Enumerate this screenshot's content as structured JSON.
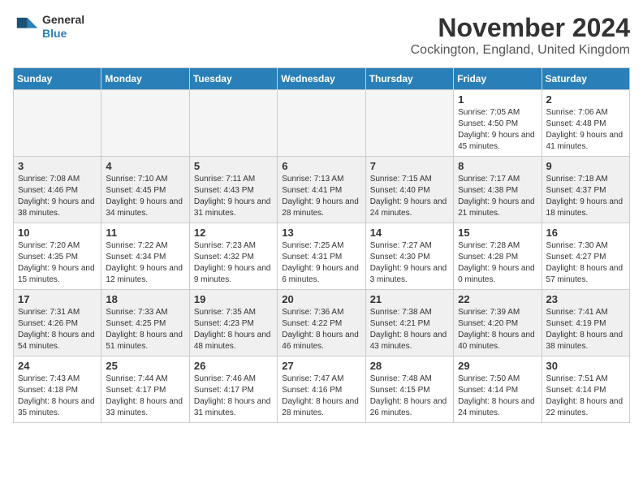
{
  "logo": {
    "line1": "General",
    "line2": "Blue"
  },
  "title": "November 2024",
  "subtitle": "Cockington, England, United Kingdom",
  "header": {
    "days": [
      "Sunday",
      "Monday",
      "Tuesday",
      "Wednesday",
      "Thursday",
      "Friday",
      "Saturday"
    ]
  },
  "weeks": [
    [
      {
        "day": "",
        "empty": true
      },
      {
        "day": "",
        "empty": true
      },
      {
        "day": "",
        "empty": true
      },
      {
        "day": "",
        "empty": true
      },
      {
        "day": "",
        "empty": true
      },
      {
        "day": "1",
        "rise": "7:05 AM",
        "set": "4:50 PM",
        "daylight": "9 hours and 45 minutes."
      },
      {
        "day": "2",
        "rise": "7:06 AM",
        "set": "4:48 PM",
        "daylight": "9 hours and 41 minutes."
      }
    ],
    [
      {
        "day": "3",
        "rise": "7:08 AM",
        "set": "4:46 PM",
        "daylight": "9 hours and 38 minutes."
      },
      {
        "day": "4",
        "rise": "7:10 AM",
        "set": "4:45 PM",
        "daylight": "9 hours and 34 minutes."
      },
      {
        "day": "5",
        "rise": "7:11 AM",
        "set": "4:43 PM",
        "daylight": "9 hours and 31 minutes."
      },
      {
        "day": "6",
        "rise": "7:13 AM",
        "set": "4:41 PM",
        "daylight": "9 hours and 28 minutes."
      },
      {
        "day": "7",
        "rise": "7:15 AM",
        "set": "4:40 PM",
        "daylight": "9 hours and 24 minutes."
      },
      {
        "day": "8",
        "rise": "7:17 AM",
        "set": "4:38 PM",
        "daylight": "9 hours and 21 minutes."
      },
      {
        "day": "9",
        "rise": "7:18 AM",
        "set": "4:37 PM",
        "daylight": "9 hours and 18 minutes."
      }
    ],
    [
      {
        "day": "10",
        "rise": "7:20 AM",
        "set": "4:35 PM",
        "daylight": "9 hours and 15 minutes."
      },
      {
        "day": "11",
        "rise": "7:22 AM",
        "set": "4:34 PM",
        "daylight": "9 hours and 12 minutes."
      },
      {
        "day": "12",
        "rise": "7:23 AM",
        "set": "4:32 PM",
        "daylight": "9 hours and 9 minutes."
      },
      {
        "day": "13",
        "rise": "7:25 AM",
        "set": "4:31 PM",
        "daylight": "9 hours and 6 minutes."
      },
      {
        "day": "14",
        "rise": "7:27 AM",
        "set": "4:30 PM",
        "daylight": "9 hours and 3 minutes."
      },
      {
        "day": "15",
        "rise": "7:28 AM",
        "set": "4:28 PM",
        "daylight": "9 hours and 0 minutes."
      },
      {
        "day": "16",
        "rise": "7:30 AM",
        "set": "4:27 PM",
        "daylight": "8 hours and 57 minutes."
      }
    ],
    [
      {
        "day": "17",
        "rise": "7:31 AM",
        "set": "4:26 PM",
        "daylight": "8 hours and 54 minutes."
      },
      {
        "day": "18",
        "rise": "7:33 AM",
        "set": "4:25 PM",
        "daylight": "8 hours and 51 minutes."
      },
      {
        "day": "19",
        "rise": "7:35 AM",
        "set": "4:23 PM",
        "daylight": "8 hours and 48 minutes."
      },
      {
        "day": "20",
        "rise": "7:36 AM",
        "set": "4:22 PM",
        "daylight": "8 hours and 46 minutes."
      },
      {
        "day": "21",
        "rise": "7:38 AM",
        "set": "4:21 PM",
        "daylight": "8 hours and 43 minutes."
      },
      {
        "day": "22",
        "rise": "7:39 AM",
        "set": "4:20 PM",
        "daylight": "8 hours and 40 minutes."
      },
      {
        "day": "23",
        "rise": "7:41 AM",
        "set": "4:19 PM",
        "daylight": "8 hours and 38 minutes."
      }
    ],
    [
      {
        "day": "24",
        "rise": "7:43 AM",
        "set": "4:18 PM",
        "daylight": "8 hours and 35 minutes."
      },
      {
        "day": "25",
        "rise": "7:44 AM",
        "set": "4:17 PM",
        "daylight": "8 hours and 33 minutes."
      },
      {
        "day": "26",
        "rise": "7:46 AM",
        "set": "4:17 PM",
        "daylight": "8 hours and 31 minutes."
      },
      {
        "day": "27",
        "rise": "7:47 AM",
        "set": "4:16 PM",
        "daylight": "8 hours and 28 minutes."
      },
      {
        "day": "28",
        "rise": "7:48 AM",
        "set": "4:15 PM",
        "daylight": "8 hours and 26 minutes."
      },
      {
        "day": "29",
        "rise": "7:50 AM",
        "set": "4:14 PM",
        "daylight": "8 hours and 24 minutes."
      },
      {
        "day": "30",
        "rise": "7:51 AM",
        "set": "4:14 PM",
        "daylight": "8 hours and 22 minutes."
      }
    ]
  ]
}
